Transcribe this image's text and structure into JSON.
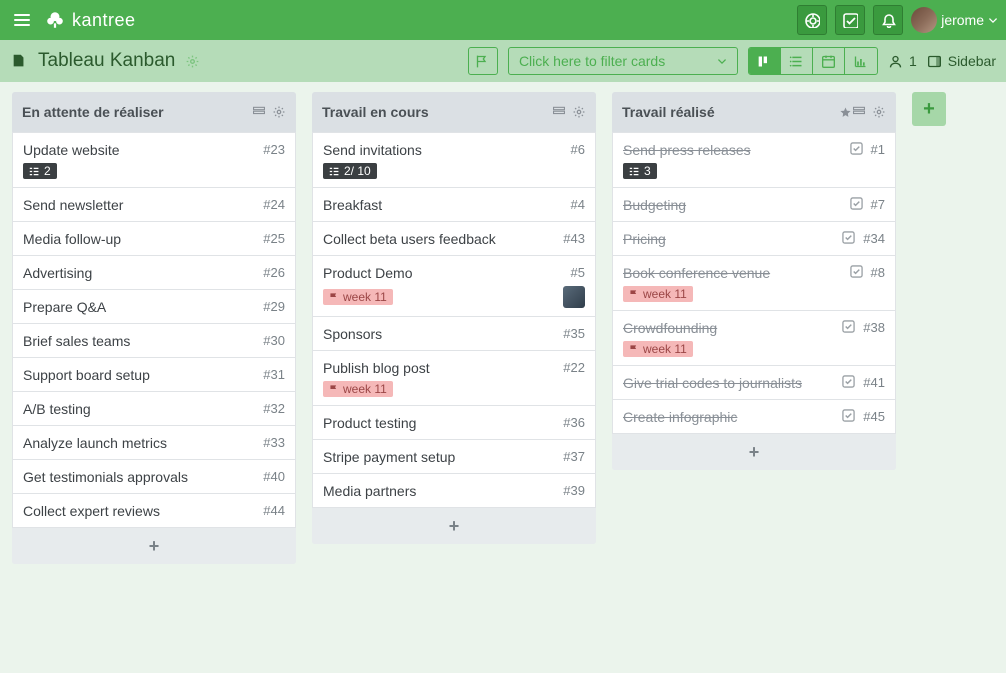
{
  "app": {
    "name": "kantree",
    "user": "jerome"
  },
  "board": {
    "title": "Tableau Kanban"
  },
  "toolbar": {
    "filter_placeholder": "Click here to filter cards",
    "people_count": "1",
    "sidebar_label": "Sidebar"
  },
  "columns": [
    {
      "title": "En attente de réaliser",
      "starred": false,
      "cards": [
        {
          "name": "Update website",
          "num": "#23",
          "badge": "2"
        },
        {
          "name": "Send newsletter",
          "num": "#24"
        },
        {
          "name": "Media follow-up",
          "num": "#25"
        },
        {
          "name": "Advertising",
          "num": "#26"
        },
        {
          "name": "Prepare Q&A",
          "num": "#29"
        },
        {
          "name": "Brief sales teams",
          "num": "#30"
        },
        {
          "name": "Support board setup",
          "num": "#31"
        },
        {
          "name": "A/B testing",
          "num": "#32"
        },
        {
          "name": "Analyze launch metrics",
          "num": "#33"
        },
        {
          "name": "Get testimonials approvals",
          "num": "#40"
        },
        {
          "name": "Collect expert reviews",
          "num": "#44"
        }
      ]
    },
    {
      "title": "Travail en cours",
      "starred": false,
      "cards": [
        {
          "name": "Send invitations",
          "num": "#6",
          "badge": "2/ 10"
        },
        {
          "name": "Breakfast",
          "num": "#4"
        },
        {
          "name": "Collect beta users feedback",
          "num": "#43"
        },
        {
          "name": "Product Demo",
          "num": "#5",
          "tag": "week 11",
          "assignee": true
        },
        {
          "name": "Sponsors",
          "num": "#35"
        },
        {
          "name": "Publish blog post",
          "num": "#22",
          "tag": "week 11"
        },
        {
          "name": "Product testing",
          "num": "#36"
        },
        {
          "name": "Stripe payment setup",
          "num": "#37"
        },
        {
          "name": "Media partners",
          "num": "#39"
        }
      ]
    },
    {
      "title": "Travail réalisé",
      "starred": true,
      "cards": [
        {
          "name": "Send press releases",
          "num": "#1",
          "done": true,
          "badge": "3"
        },
        {
          "name": "Budgeting",
          "num": "#7",
          "done": true
        },
        {
          "name": "Pricing",
          "num": "#34",
          "done": true
        },
        {
          "name": "Book conference venue",
          "num": "#8",
          "done": true,
          "tag": "week 11"
        },
        {
          "name": "Crowdfounding",
          "num": "#38",
          "done": true,
          "tag": "week 11"
        },
        {
          "name": "Give trial codes to journalists",
          "num": "#41",
          "done": true
        },
        {
          "name": "Create infographic",
          "num": "#45",
          "done": true
        }
      ]
    }
  ]
}
